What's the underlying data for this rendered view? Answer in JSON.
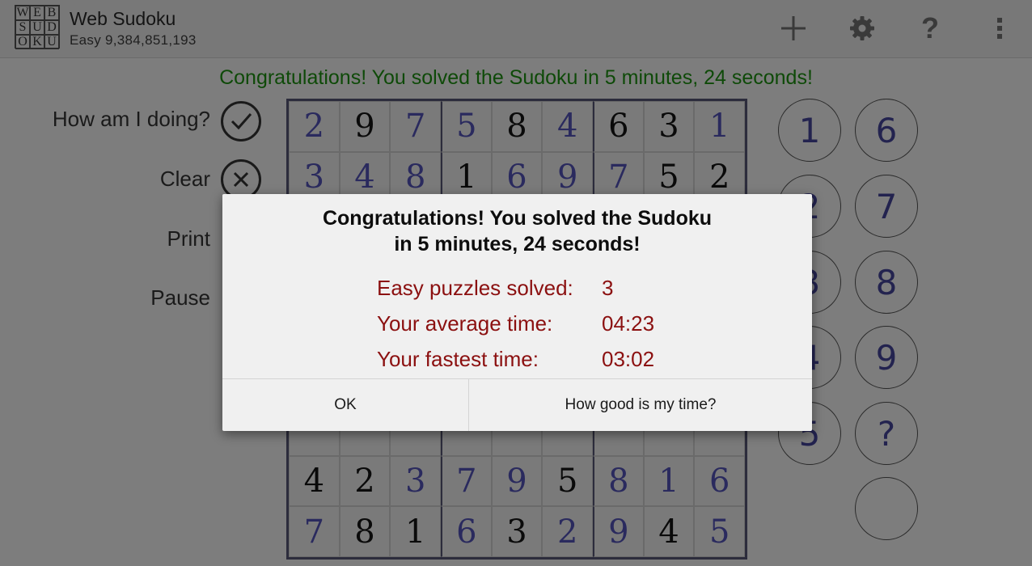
{
  "app": {
    "logo_letters": [
      "W",
      "E",
      "B",
      "S",
      "U",
      "D",
      "O",
      "K",
      "U"
    ],
    "title": "Web Sudoku",
    "subtitle": "Easy 9,384,851,193",
    "help_glyph": "?"
  },
  "icons": [
    "add-icon",
    "gear-icon",
    "help-icon",
    "overflow-menu-icon",
    "checkmark-icon",
    "close-icon"
  ],
  "banner": "Congratulations! You solved the Sudoku in 5 minutes, 24 seconds!",
  "side_actions": {
    "check": "How am I doing?",
    "clear": "Clear",
    "print": "Print",
    "pause": "Pause"
  },
  "board": {
    "rows": [
      [
        "2",
        "9",
        "7",
        "5",
        "8",
        "4",
        "6",
        "3",
        "1"
      ],
      [
        "3",
        "4",
        "8",
        "1",
        "6",
        "9",
        "7",
        "5",
        "2"
      ],
      [
        "",
        "",
        "",
        "",
        "",
        "",
        "",
        "",
        ""
      ],
      [
        "",
        "",
        "",
        "",
        "",
        "",
        "",
        "",
        ""
      ],
      [
        "",
        "",
        "",
        "",
        "",
        "",
        "",
        "",
        ""
      ],
      [
        "",
        "",
        "",
        "",
        "",
        "",
        "",
        "",
        ""
      ],
      [
        "",
        "",
        "",
        "",
        "",
        "",
        "",
        "",
        ""
      ],
      [
        "4",
        "2",
        "3",
        "7",
        "9",
        "5",
        "8",
        "1",
        "6"
      ],
      [
        "7",
        "8",
        "1",
        "6",
        "3",
        "2",
        "9",
        "4",
        "5"
      ]
    ],
    "kinds": [
      [
        "e",
        "g",
        "e",
        "e",
        "g",
        "e",
        "g",
        "g",
        "e"
      ],
      [
        "e",
        "e",
        "e",
        "g",
        "e",
        "e",
        "e",
        "g",
        "g"
      ],
      [
        "e",
        "e",
        "e",
        "e",
        "e",
        "e",
        "e",
        "e",
        "e"
      ],
      [
        "e",
        "e",
        "e",
        "e",
        "e",
        "e",
        "e",
        "e",
        "e"
      ],
      [
        "e",
        "e",
        "e",
        "e",
        "e",
        "e",
        "e",
        "e",
        "e"
      ],
      [
        "e",
        "e",
        "e",
        "e",
        "e",
        "e",
        "e",
        "e",
        "e"
      ],
      [
        "e",
        "e",
        "e",
        "e",
        "e",
        "e",
        "e",
        "e",
        "e"
      ],
      [
        "g",
        "g",
        "e",
        "e",
        "e",
        "g",
        "e",
        "e",
        "e"
      ],
      [
        "e",
        "g",
        "g",
        "e",
        "g",
        "e",
        "e",
        "g",
        "e"
      ]
    ]
  },
  "number_pad": {
    "left_col": [
      "1",
      "2",
      "3",
      "4",
      "5"
    ],
    "right_col": [
      "6",
      "7",
      "8",
      "9",
      "?",
      ""
    ]
  },
  "dialog": {
    "title_line1": "Congratulations! You solved the Sudoku",
    "title_line2": "in 5 minutes, 24 seconds!",
    "stats": [
      {
        "label": "Easy puzzles solved:",
        "value": "3"
      },
      {
        "label": "Your average time:",
        "value": "04:23"
      },
      {
        "label": "Your fastest time:",
        "value": "03:02"
      }
    ],
    "ok_label": "OK",
    "how_label": "How good is my time?"
  }
}
